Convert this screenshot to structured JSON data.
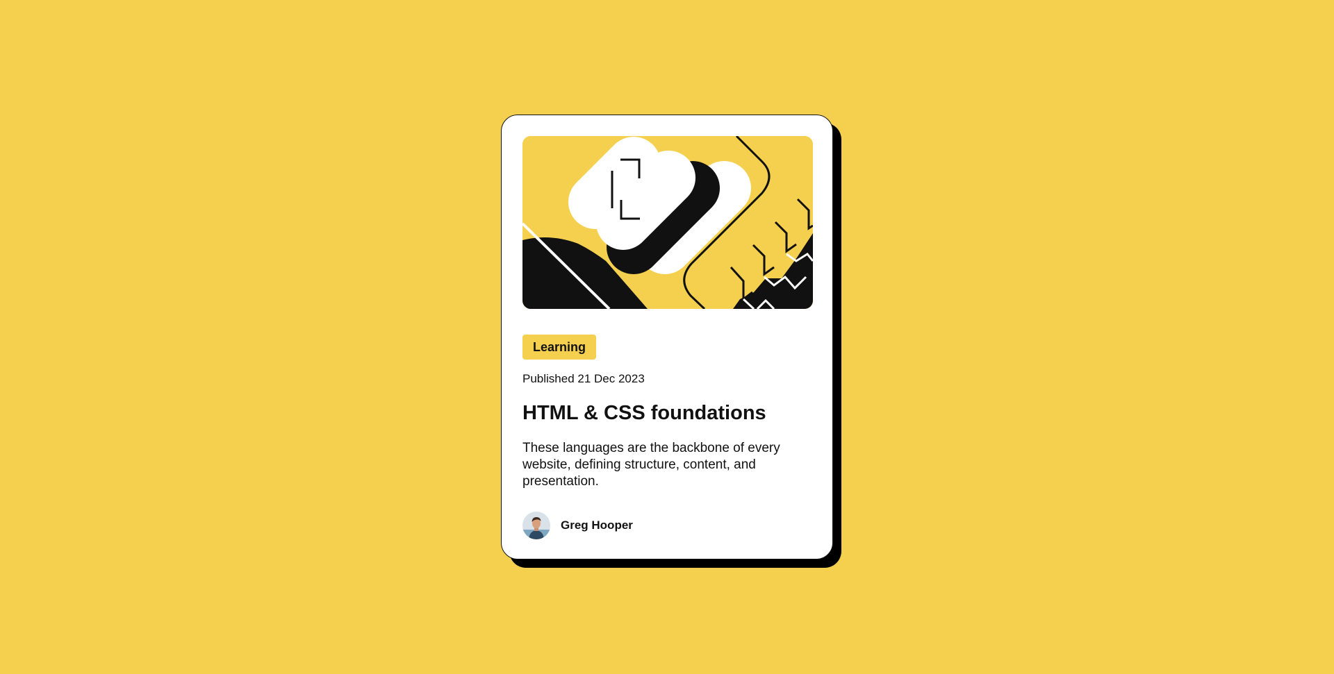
{
  "colors": {
    "background": "#F4D04E",
    "card": "#FFFFFF",
    "ink": "#111111",
    "shadow": "#000000"
  },
  "card": {
    "illustration_name": "abstract-yellow-black-illustration",
    "tag": "Learning",
    "published": "Published 21 Dec 2023",
    "title": "HTML & CSS foundations",
    "description": "These languages are the backbone of every website, defining structure, content, and presentation.",
    "author": {
      "name": "Greg Hooper",
      "avatar_icon": "avatar-image"
    }
  }
}
